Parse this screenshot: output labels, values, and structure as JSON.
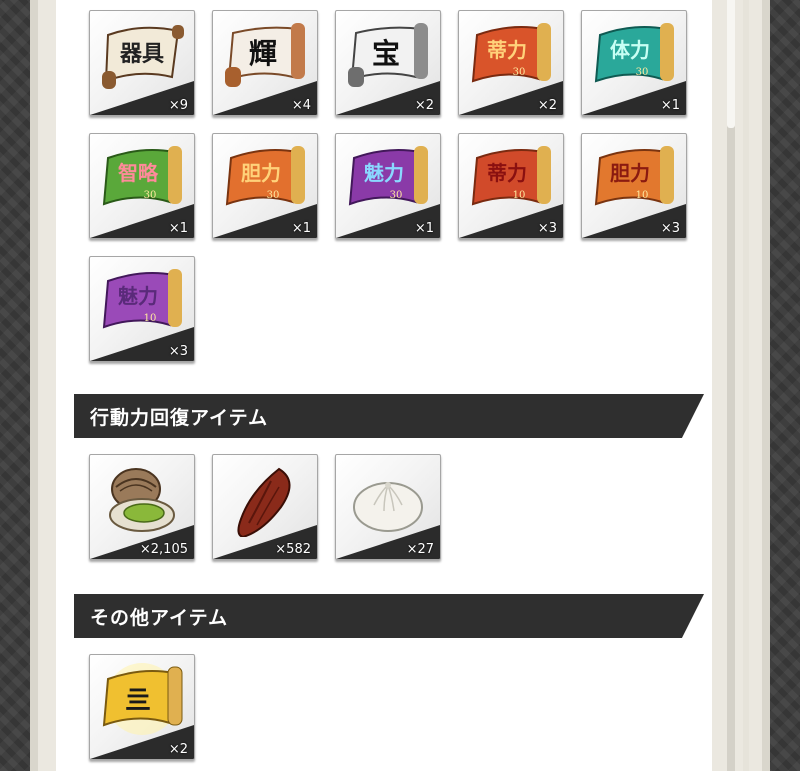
{
  "sections": {
    "top_items": [
      {
        "icon": "scroll-equipment-icon",
        "count": "×9"
      },
      {
        "icon": "scroll-shine-icon",
        "count": "×4"
      },
      {
        "icon": "scroll-treasure-icon",
        "count": "×2"
      },
      {
        "icon": "scroll-military-30-icon",
        "count": "×2"
      },
      {
        "icon": "scroll-stamina-30-icon",
        "count": "×1"
      },
      {
        "icon": "scroll-wisdom-30-icon",
        "count": "×1"
      },
      {
        "icon": "scroll-courage-30-icon",
        "count": "×1"
      },
      {
        "icon": "scroll-charm-30-icon",
        "count": "×1"
      },
      {
        "icon": "scroll-military-10-icon",
        "count": "×3"
      },
      {
        "icon": "scroll-courage-10-icon",
        "count": "×3"
      },
      {
        "icon": "scroll-charm-10-icon",
        "count": "×3"
      }
    ],
    "action_recovery": {
      "title": "行動力回復アイテム",
      "items": [
        {
          "icon": "clam-shell-icon",
          "count": "×2,105"
        },
        {
          "icon": "dried-date-icon",
          "count": "×582"
        },
        {
          "icon": "steamed-bun-icon",
          "count": "×27"
        }
      ]
    },
    "other": {
      "title": "その他アイテム",
      "items": [
        {
          "icon": "golden-scroll-icon",
          "count": "×2"
        }
      ]
    }
  },
  "colors": {
    "section_bar": "#2f2f2f",
    "panel": "#ffffff",
    "page_bg": "#3b3b3b"
  }
}
